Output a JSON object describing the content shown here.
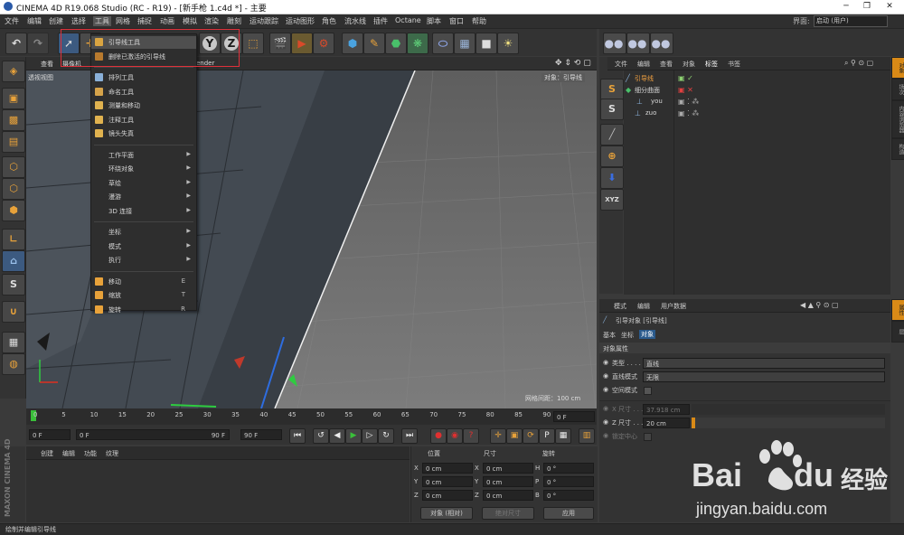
{
  "window": {
    "title": "CINEMA 4D R19.068 Studio (RC - R19) - [新手枪 1.c4d *] - 主要",
    "minimize": "─",
    "maximize": "❐",
    "close": "✕"
  },
  "menubar": {
    "items": [
      "文件",
      "编辑",
      "创建",
      "选择",
      "工具",
      "网格",
      "捕捉",
      "动画",
      "模拟",
      "渲染",
      "雕刻",
      "运动跟踪",
      "运动图形",
      "角色",
      "流水线",
      "插件",
      "Octane",
      "脚本",
      "窗口",
      "帮助"
    ],
    "layout_label": "界面:",
    "layout_value": "启动 (用户)"
  },
  "toolbar": {
    "axis_y": "Y",
    "axis_z": "Z"
  },
  "viewport": {
    "menu": [
      "查看",
      "摄像机",
      "显示",
      "选项",
      "过滤",
      "面板",
      "ProRender"
    ],
    "prorender": "ender",
    "view_name": "透视视图",
    "selected_object_label": "对象：引导线",
    "grid_spacing": "网格间距：100 cm"
  },
  "tools_menu": {
    "items": [
      {
        "label": "引导线工具",
        "shortcut": "",
        "submenu": false,
        "icon_color": "#d9a441",
        "highlight": true
      },
      {
        "label": "删除已激活的引导线",
        "shortcut": "",
        "submenu": false,
        "icon_color": "#b87a2e",
        "highlight": false
      },
      {
        "label": "",
        "separator": true
      },
      {
        "label": "排列工具",
        "shortcut": "",
        "submenu": false,
        "icon_color": "#8ab0d8",
        "highlight": false
      },
      {
        "label": "命名工具",
        "shortcut": "",
        "submenu": false,
        "icon_color": "#d6a34a",
        "highlight": false
      },
      {
        "label": "测量和移动",
        "shortcut": "",
        "submenu": false,
        "icon_color": "#e0b24f",
        "highlight": false
      },
      {
        "label": "注释工具",
        "shortcut": "",
        "submenu": false,
        "icon_color": "#e0b24f",
        "highlight": false
      },
      {
        "label": "镜头失真",
        "shortcut": "",
        "submenu": false,
        "icon_color": "#e0b24f",
        "highlight": false
      },
      {
        "label": "",
        "separator": true
      },
      {
        "label": "工作平面",
        "shortcut": "",
        "submenu": true,
        "icon_color": "",
        "highlight": false
      },
      {
        "label": "环绕对象",
        "shortcut": "",
        "submenu": true,
        "icon_color": "",
        "highlight": false
      },
      {
        "label": "草绘",
        "shortcut": "",
        "submenu": true,
        "icon_color": "",
        "highlight": false
      },
      {
        "label": "漫游",
        "shortcut": "",
        "submenu": true,
        "icon_color": "",
        "highlight": false
      },
      {
        "label": "3D 连接",
        "shortcut": "",
        "submenu": true,
        "icon_color": "",
        "highlight": false
      },
      {
        "label": "",
        "separator": true
      },
      {
        "label": "坐标",
        "shortcut": "",
        "submenu": true,
        "icon_color": "",
        "highlight": false
      },
      {
        "label": "模式",
        "shortcut": "",
        "submenu": true,
        "icon_color": "",
        "highlight": false
      },
      {
        "label": "执行",
        "shortcut": "",
        "submenu": true,
        "icon_color": "",
        "highlight": false
      },
      {
        "label": "",
        "separator": true
      },
      {
        "label": "移动",
        "shortcut": "E",
        "submenu": false,
        "icon_color": "#e8a23a",
        "highlight": false
      },
      {
        "label": "缩放",
        "shortcut": "T",
        "submenu": false,
        "icon_color": "#e8a23a",
        "highlight": false
      },
      {
        "label": "旋转",
        "shortcut": "R",
        "submenu": false,
        "icon_color": "#e8a23a",
        "highlight": false
      }
    ]
  },
  "timeline": {
    "ticks": [
      "0",
      "5",
      "10",
      "15",
      "20",
      "25",
      "30",
      "35",
      "40",
      "45",
      "50",
      "55",
      "60",
      "65",
      "70",
      "75",
      "80",
      "85",
      "90"
    ],
    "current_frame_field": "0 F",
    "start_field": "0 F",
    "range_start": "0 F",
    "range_end": "90 F",
    "end_field": "90 F"
  },
  "materials": {
    "tabs": [
      "创建",
      "编辑",
      "功能",
      "纹理"
    ]
  },
  "coordinates": {
    "headers": [
      "位置",
      "尺寸",
      "旋转"
    ],
    "rows": [
      {
        "axis": "X",
        "pos": "0 cm",
        "size_axis": "X",
        "size": "0 cm",
        "rot_axis": "H",
        "rot": "0 °"
      },
      {
        "axis": "Y",
        "pos": "0 cm",
        "size_axis": "Y",
        "size": "0 cm",
        "rot_axis": "P",
        "rot": "0 °"
      },
      {
        "axis": "Z",
        "pos": "0 cm",
        "size_axis": "Z",
        "size": "0 cm",
        "rot_axis": "B",
        "rot": "0 °"
      }
    ],
    "mode_select": "对象 (相对)",
    "size_select": "绝对尺寸",
    "apply_button": "应用"
  },
  "maxon_logo": "MAXON CINEMA 4D",
  "status_text": "绘制并编辑引导线",
  "object_manager": {
    "menu": [
      "文件",
      "编辑",
      "查看",
      "对象",
      "标签",
      "书签"
    ],
    "objects": [
      {
        "name": "引导线",
        "indent": 0
      },
      {
        "name": "细分曲面",
        "indent": 0
      },
      {
        "name": "you",
        "indent": 1
      },
      {
        "name": "zuo",
        "indent": 0
      }
    ]
  },
  "side_tabs": [
    "对象",
    "场次",
    "内容浏览器",
    "构造"
  ],
  "attributes": {
    "menu": [
      "模式",
      "编辑",
      "用户数据"
    ],
    "object_title": "引导对象 [引导线]",
    "tabs": [
      "基本",
      "坐标",
      "对象"
    ],
    "section": "对象属性",
    "fields": [
      {
        "label": "类型 . . . . .",
        "value": "直线"
      },
      {
        "label": "直线模式",
        "value": "无限"
      },
      {
        "label": "空间模式",
        "value": ""
      }
    ],
    "x_size_label": "X 尺寸 . . .",
    "x_size_value": "37.918 cm",
    "z_size_label": "Z 尺寸 . . .",
    "z_size_value": "20 cm",
    "lock_center": "锁定中心",
    "side_tab": "属性",
    "side_tab2": "层"
  },
  "watermark": {
    "text1": "Bai",
    "text2": "du",
    "text3": "经验",
    "url": "jingyan.baidu.com"
  }
}
